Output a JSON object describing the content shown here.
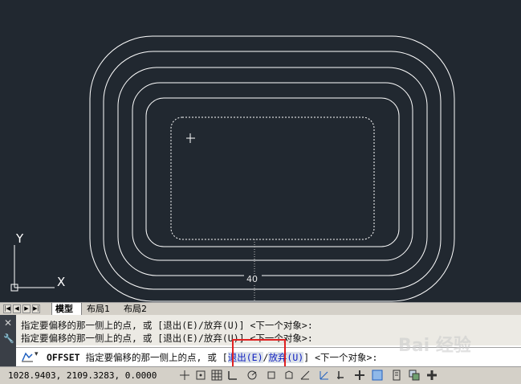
{
  "canvas": {
    "background": "#212830",
    "axis": {
      "x_label": "X",
      "y_label": "Y"
    },
    "dimension_label": "40"
  },
  "tabs": {
    "nav_first": "|◀",
    "nav_prev": "◀",
    "nav_next": "▶",
    "nav_last": "▶|",
    "items": [
      {
        "label": "模型"
      },
      {
        "label": "布局1"
      },
      {
        "label": "布局2"
      }
    ]
  },
  "command": {
    "close_icon": "close-icon",
    "history": [
      "指定要偏移的那一侧上的点, 或 [退出(E)/放弃(U)] <下一个对象>:",
      "指定要偏移的那一侧上的点, 或 [退出(E)/放弃(U)] <下一个对象>:"
    ],
    "input": {
      "command_name": "OFFSET",
      "prompt": "指定要偏移的那一侧上的点, 或",
      "bracket_open": "[",
      "option_exit": "退出(E)",
      "option_undo": "放弃(U)",
      "bracket_close": "]",
      "default": "<下一个对象>:"
    }
  },
  "status": {
    "coordinates": "1028.9403, 2109.3283, 0.0000"
  },
  "colors": {
    "accent_red": "#e02020",
    "option_blue": "#1020c0"
  }
}
